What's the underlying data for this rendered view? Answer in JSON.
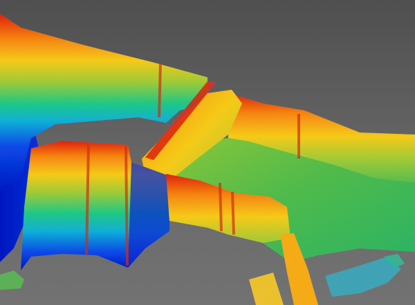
{
  "scene": {
    "description_visible_text": "",
    "colormap": [
      "#0018c8",
      "#0a4cf0",
      "#11b6e0",
      "#20d08a",
      "#a6d23a",
      "#ffd21a",
      "#ff8a12",
      "#e8220e"
    ],
    "background": "#5f5f5f"
  }
}
